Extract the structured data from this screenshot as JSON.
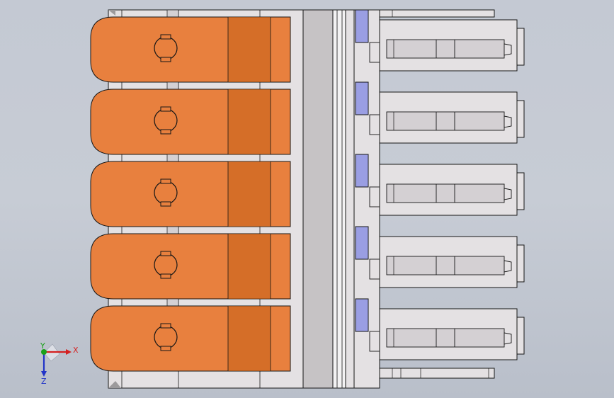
{
  "viewport": {
    "name": "graphics-area",
    "background_color": "#c7ccd5"
  },
  "model": {
    "clamp_count": 5,
    "colors": {
      "lever": "#e8803e",
      "lever_groove": "#c55f16",
      "housing": "#e4e1e3",
      "housing_shade": "#d4d0d3",
      "outline": "#161616",
      "accent_blue": "#9a9ee3"
    },
    "icons": [
      "lever-latch-icon"
    ]
  },
  "triad": {
    "x_label": "X",
    "y_label": "Y",
    "z_label": "Z",
    "x_color": "#d42020",
    "y_color": "#1aa11a",
    "z_color": "#2234c8"
  }
}
